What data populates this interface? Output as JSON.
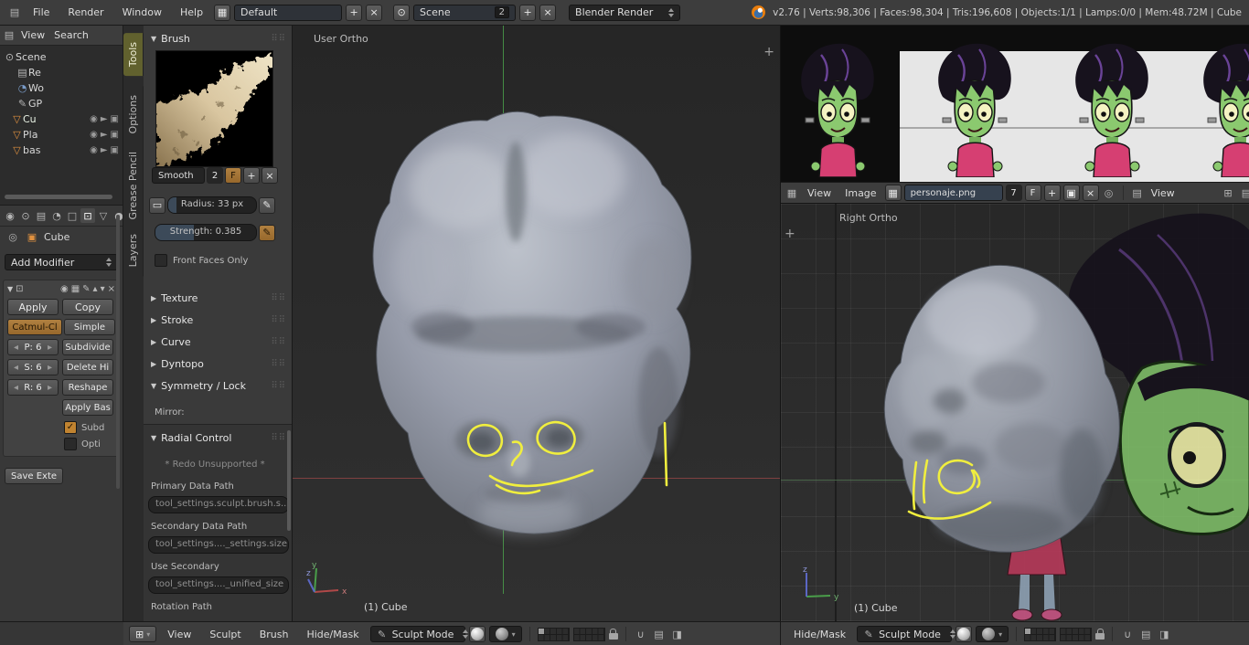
{
  "topbar": {
    "menus": [
      "File",
      "Render",
      "Window",
      "Help"
    ],
    "layout": "Default",
    "scene": "Scene",
    "scene_users": "2",
    "engine": "Blender Render",
    "stats": "v2.76 | Verts:98,306 | Faces:98,304 | Tris:196,608 | Objects:1/1 | Lamps:0/0 | Mem:48.72M | Cube"
  },
  "outliner": {
    "menus": [
      "View",
      "Search"
    ],
    "items": [
      "Scene",
      "Re",
      "Wo",
      "GP",
      "Cu",
      "Pla",
      "bas"
    ]
  },
  "props": {
    "name": "Cube",
    "add_modifier": "Add Modifier",
    "apply": "Apply",
    "copy": "Copy",
    "catmull": "Catmul-Cl",
    "simple": "Simple",
    "preview_level": "P: 6",
    "subdivide": "Subdivide",
    "sculpt_level": "S: 6",
    "delete_higher": "Delete Hi",
    "render_level": "R: 6",
    "reshape": "Reshape",
    "apply_base": "Apply Bas",
    "subd": "Subd",
    "opti": "Opti",
    "save_external": "Save Exte"
  },
  "shelf": {
    "tabs": [
      "Tools",
      "Options",
      "Grease Pencil",
      "Layers"
    ],
    "brush_title": "Brush",
    "brush_name": "Smooth",
    "brush_users": "2",
    "fake_user": "F",
    "radius": "Radius: 33 px",
    "strength": "Strength: 0.385",
    "front_faces": "Front Faces Only",
    "panels": [
      "Texture",
      "Stroke",
      "Curve",
      "Dyntopo"
    ],
    "symmetry": "Symmetry / Lock",
    "mirror": "Mirror:",
    "radial": {
      "title": "Radial Control",
      "redo": "* Redo Unsupported *",
      "primary_label": "Primary Data Path",
      "primary": "tool_settings.sculpt.brush.s...",
      "secondary_label": "Secondary Data Path",
      "secondary": "tool_settings...._settings.size",
      "use_secondary_label": "Use Secondary",
      "use_secondary": "tool_settings...._unified_size",
      "rotation_label": "Rotation Path"
    }
  },
  "vp_main": {
    "label": "User Ortho",
    "object": "(1) Cube"
  },
  "vp_right": {
    "label": "Right Ortho",
    "object": "(1) Cube"
  },
  "header3d": {
    "menus": [
      "View",
      "Sculpt",
      "Brush",
      "Hide/Mask"
    ],
    "mode": "Sculpt Mode"
  },
  "header3d_right": {
    "menu": "Hide/Mask",
    "mode": "Sculpt Mode"
  },
  "image_editor": {
    "menus": [
      "View",
      "Image"
    ],
    "image_name": "personaje.png",
    "users": "7",
    "fake_user": "F",
    "view_label": "View"
  },
  "gizmo": {
    "x": "x",
    "y": "y",
    "z": "z"
  },
  "colors": {
    "accent": "#e87d0d",
    "annotation": "#f0ee3e",
    "axis_green": "#4a9e4a",
    "axis_red": "#9a4848",
    "tab_active": "#61612e",
    "selected_warm": "#9a702e"
  }
}
